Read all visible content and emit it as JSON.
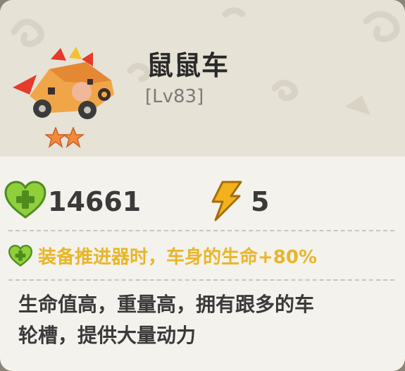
{
  "vehicle": {
    "name": "鼠鼠车",
    "level": "[Lv83]",
    "stars": 2,
    "icon": "rat-car-icon"
  },
  "stats": {
    "hp": "14661",
    "hp_icon": "green-heart-icon",
    "energy": "5",
    "energy_icon": "lightning-icon"
  },
  "bonus": {
    "text": "装备推进器时，车身的生命+80%",
    "color": "#e8b62a"
  },
  "description": {
    "line1": "生命值高，重量高，拥有跟多的车",
    "line2": "轮槽，提供大量动力"
  }
}
